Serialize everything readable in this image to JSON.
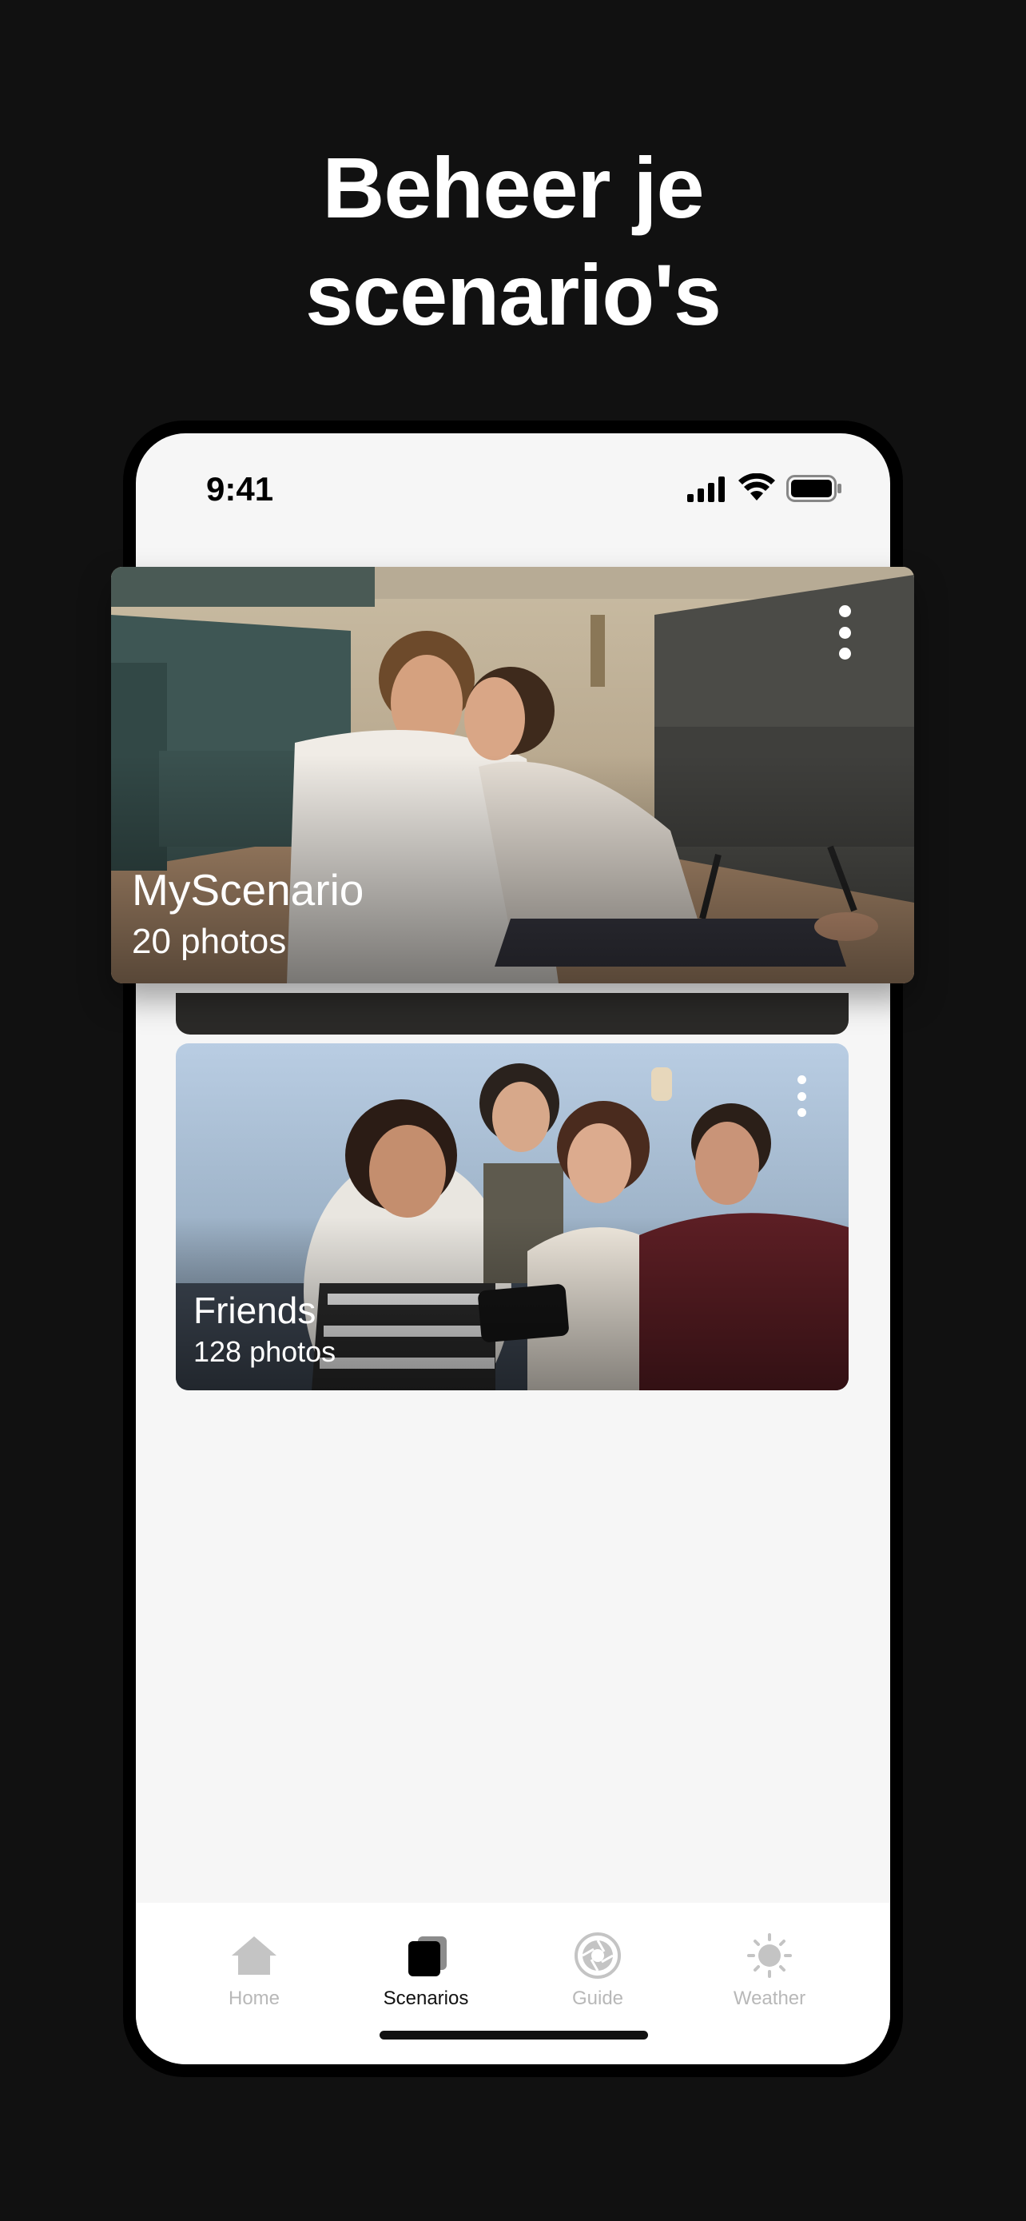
{
  "headline": {
    "line1": "Beheer je",
    "line2": "scenario's"
  },
  "status_bar": {
    "time": "9:41"
  },
  "scenarios": [
    {
      "name": "MyScenario",
      "count": "20 photos",
      "menu_icon": "more-vertical-icon"
    },
    {
      "name": "Friends",
      "count": "128 photos",
      "menu_icon": "more-vertical-icon"
    }
  ],
  "tab_bar": {
    "items": [
      {
        "label": "Home",
        "icon": "home-icon",
        "active": false
      },
      {
        "label": "Scenarios",
        "icon": "scenarios-icon",
        "active": true
      },
      {
        "label": "Guide",
        "icon": "guide-icon",
        "active": false
      },
      {
        "label": "Weather",
        "icon": "weather-icon",
        "active": false
      }
    ]
  },
  "colors": {
    "background": "#111111",
    "screen": "#f6f6f6",
    "tab_active": "#111111",
    "tab_inactive": "#b8b8b8"
  }
}
